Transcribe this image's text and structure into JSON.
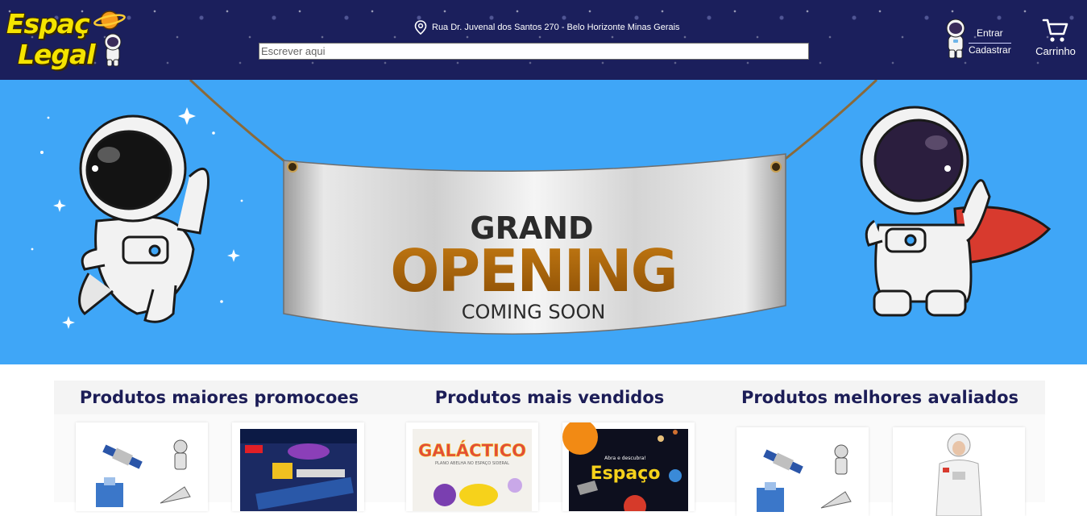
{
  "header": {
    "logo": {
      "line1": "Espaç",
      "line2": "Legal"
    },
    "address": "Rua Dr. Juvenal dos Santos 270 - Belo Horizonte Minas Gerais",
    "search_placeholder": "Escrever aqui",
    "login_label": "Entrar",
    "signup_label": "Cadastrar",
    "cart_label": "Carrinho"
  },
  "banner": {
    "line1": "GRAND",
    "line2": "OPENING",
    "line3": "COMING SOON"
  },
  "categories": [
    {
      "title": "Produtos maiores promocoes"
    },
    {
      "title": "Produtos mais vendidos",
      "product_texts": [
        "GALÁCTICO",
        "PLANO ABELHA NO ESPAÇO SIDERAL",
        "Abra e descubra!",
        "Espaço"
      ]
    },
    {
      "title": "Produtos melhores avaliados"
    }
  ],
  "colors": {
    "header_bg": "#1b1f5c",
    "banner_bg": "#3fa6f7",
    "title_text": "#1c1d57",
    "logo_yellow": "#f5e400",
    "opening_gold": "#a8670e"
  }
}
